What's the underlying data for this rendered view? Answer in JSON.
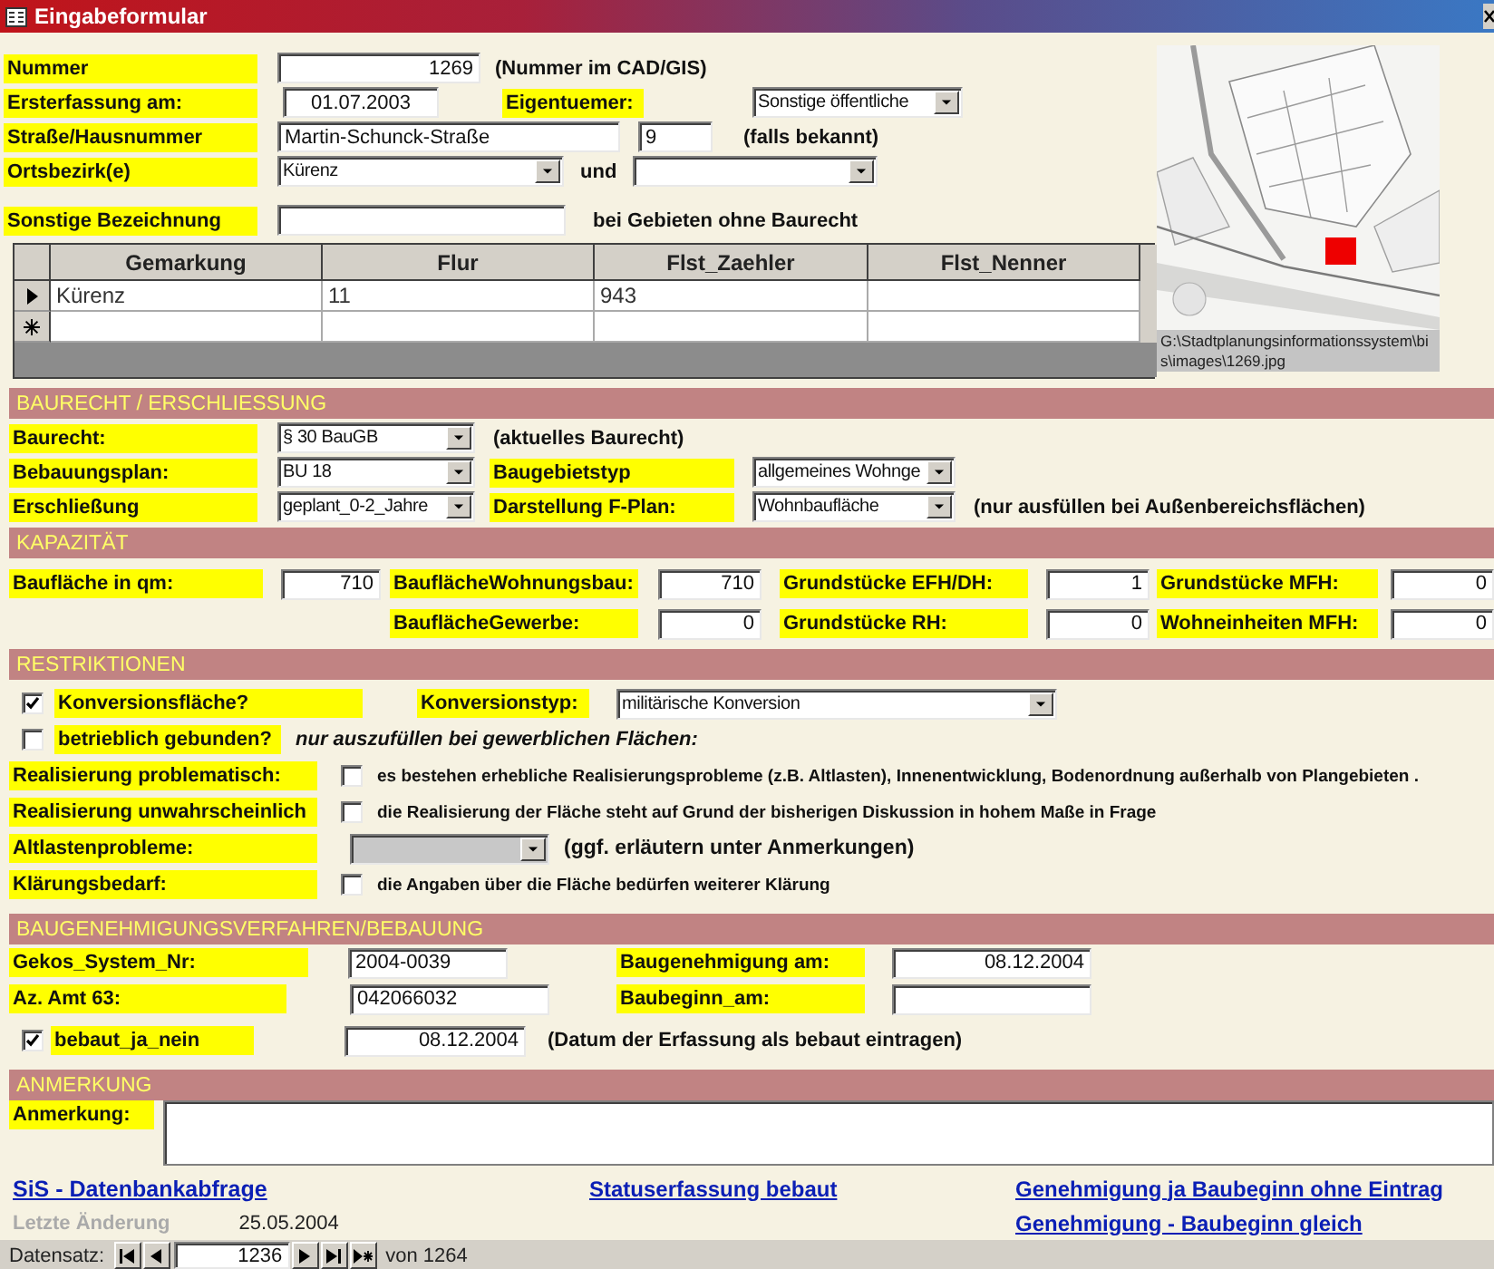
{
  "window": {
    "title": "Eingabeformular"
  },
  "general": {
    "nummer": {
      "label": "Nummer",
      "value": "1269",
      "note": "(Nummer im CAD/GIS)"
    },
    "ersterfassung": {
      "label": "Ersterfassung am:",
      "value": "01.07.2003"
    },
    "eigentuemer": {
      "label": "Eigentuemer:",
      "value": "Sonstige öffentliche"
    },
    "strasse": {
      "label": "Straße/Hausnummer",
      "street": "Martin-Schunck-Straße",
      "number": "9",
      "note": "(falls bekannt)"
    },
    "ortsbezirk": {
      "label": "Ortsbezirk(e)",
      "value": "Kürenz",
      "joiner": "und"
    },
    "sonstige": {
      "label": "Sonstige Bezeichnung",
      "note": "bei Gebieten ohne Baurecht"
    }
  },
  "parcels": {
    "columns": [
      "Gemarkung",
      "Flur",
      "Flst_Zaehler",
      "Flst_Nenner"
    ],
    "rows": [
      {
        "selected": true,
        "cells": [
          "Kürenz",
          "11",
          "943"
        ]
      }
    ]
  },
  "map": {
    "caption": "G:\\Stadtplanungsinformationssystem\\bis\\images\\1269.jpg"
  },
  "baurecht": {
    "title": "BAURECHT / ERSCHLIESSUNG",
    "baurecht": {
      "label": "Baurecht:",
      "value": "§ 30 BauGB",
      "note": "(aktuelles Baurecht)"
    },
    "bebauungsplan": {
      "label": "Bebauungsplan:",
      "value": "BU 18"
    },
    "baugebietstyp": {
      "label": "Baugebietstyp",
      "value": "allgemeines Wohnge"
    },
    "erschliessung": {
      "label": "Erschließung",
      "value": "geplant_0-2_Jahre"
    },
    "fplan": {
      "label": "Darstellung F-Plan:",
      "value": "Wohnbaufläche",
      "note": "(nur ausfüllen bei Außenbereichsflächen)"
    }
  },
  "kapazitaet": {
    "title": "KAPAZITÄT",
    "fields": [
      {
        "label": "Baufläche in qm:",
        "value": "710"
      },
      {
        "label": "BauflächeWohnungsbau:",
        "value": "710"
      },
      {
        "label": "Grundstücke EFH/DH:",
        "value": "1"
      },
      {
        "label": "Grundstücke MFH:",
        "value": "0"
      },
      {
        "label": "BauflächeGewerbe:",
        "value": "0"
      },
      {
        "label": "Grundstücke RH:",
        "value": "0"
      },
      {
        "label": "Wohneinheiten MFH:",
        "value": "0"
      }
    ]
  },
  "restriktionen": {
    "title": "RESTRIKTIONEN",
    "konversion": {
      "label": "Konversionsfläche?",
      "checked": true
    },
    "konversionstyp": {
      "label": "Konversionstyp:",
      "value": "militärische Konversion"
    },
    "betrieblich": {
      "label": "betrieblich gebunden?",
      "checked": false,
      "note": "nur auszufüllen bei gewerblichen Flächen:"
    },
    "items": [
      {
        "kind": "check",
        "label": "Realisierung problematisch:",
        "checked": false,
        "text": "es bestehen erhebliche Realisierungsprobleme (z.B. Altlasten), Innenentwicklung, Bodenordnung außerhalb von Plangebieten ."
      },
      {
        "kind": "check",
        "label": "Realisierung unwahrscheinlich",
        "checked": false,
        "text": "die Realisierung der Fläche steht auf Grund der bisherigen Diskussion in hohem Maße in Frage"
      },
      {
        "kind": "dropdown",
        "label": "Altlastenprobleme:",
        "disabled": true,
        "text": "(ggf. erläutern unter Anmerkungen)"
      },
      {
        "kind": "check",
        "label": "Klärungsbedarf:",
        "checked": false,
        "text": "die Angaben über die Fläche bedürfen weiterer Klärung"
      }
    ]
  },
  "baugenehmigung": {
    "title": "BAUGENEHMIGUNGSVERFAHREN/BEBAUUNG",
    "gekos": {
      "label": "Gekos_System_Nr:",
      "value": "2004-0039"
    },
    "genehmigung": {
      "label": "Baugenehmigung am:",
      "value": "08.12.2004"
    },
    "az": {
      "label": "Az. Amt 63:",
      "value": "042066032"
    },
    "baubeginn": {
      "label": "Baubeginn_am:"
    },
    "bebaut": {
      "label": "bebaut_ja_nein",
      "checked": true,
      "value": "08.12.2004",
      "note": "(Datum der Erfassung als bebaut eintragen)"
    }
  },
  "anmerkung": {
    "title": "ANMERKUNG",
    "label": "Anmerkung:"
  },
  "footer": {
    "links": [
      "SiS - Datenbankabfrage",
      "Statuserfassung bebaut",
      "Genehmigung ja Baubeginn ohne Eintrag",
      "Genehmigung - Baubeginn gleich"
    ],
    "last_change_label": "Letzte Änderung",
    "last_change": "25.05.2004"
  },
  "record_nav": {
    "label": "Datensatz:",
    "current": "1236",
    "total": "von 1264"
  }
}
